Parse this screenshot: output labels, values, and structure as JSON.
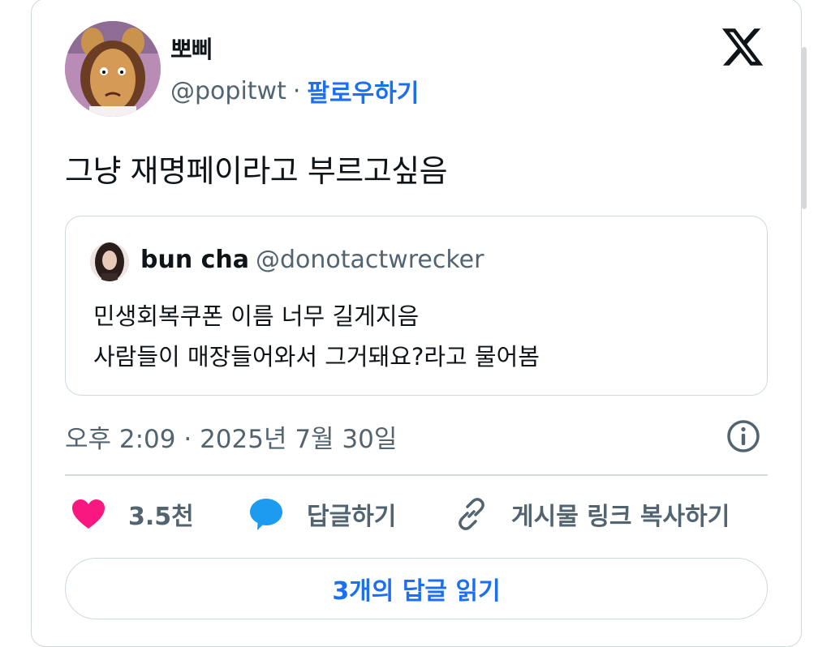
{
  "author": {
    "name": "뽀삐",
    "handle": "@popitwt",
    "separator": "·",
    "follow_label": "팔로우하기"
  },
  "tweet": {
    "text": "그냥 재명페이라고 부르고싶음"
  },
  "quoted": {
    "name": "bun cha",
    "handle": "@donotactwrecker",
    "line1": "민생회복쿠폰 이름 너무 길게지음",
    "line2": "사람들이 매장들어와서 그거돼요?라고 물어봄"
  },
  "meta": {
    "timestamp": "오후 2:09 · 2025년 7월 30일"
  },
  "actions": {
    "like_count": "3.5천",
    "reply_label": "답글하기",
    "copy_link_label": "게시물 링크 복사하기"
  },
  "read_replies_label": "3개의 답글 읽기",
  "colors": {
    "accent": "#1d6ff2",
    "like": "#f91880",
    "reply_icon": "#1d9bf0",
    "muted": "#536471"
  },
  "icons": [
    "x-logo-icon",
    "info-icon",
    "heart-icon",
    "reply-bubble-icon",
    "link-icon"
  ]
}
